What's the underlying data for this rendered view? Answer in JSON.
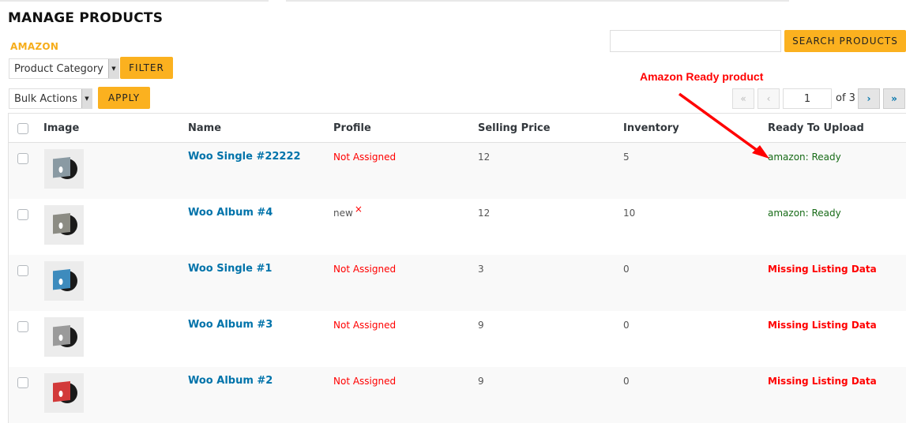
{
  "header": {
    "title": "MANAGE PRODUCTS",
    "store": "AMAZON"
  },
  "filters": {
    "category_select": "Product Category",
    "filter_label": "FILTER",
    "bulk_select": "Bulk Actions",
    "apply_label": "APPLY"
  },
  "search": {
    "value": "",
    "placeholder": "",
    "button_label": "SEARCH PRODUCTS"
  },
  "annotation": {
    "text": "Amazon Ready product",
    "color": "#ff0000"
  },
  "pagination": {
    "first": "«",
    "prev": "‹",
    "current": "1",
    "of_text": "of 3",
    "next": "›",
    "last": "»"
  },
  "table": {
    "columns": [
      "Image",
      "Name",
      "Profile",
      "Selling Price",
      "Inventory",
      "Ready To Upload"
    ],
    "rows": [
      {
        "name": "Woo Single #22222",
        "profile": "Not Assigned",
        "price": "12",
        "inventory": "5",
        "status": "amazon: Ready",
        "thumb_color": "#8a9aa3"
      },
      {
        "name": "Woo Album #4",
        "profile": "new",
        "profile_remove": "×",
        "price": "12",
        "inventory": "10",
        "status": "amazon: Ready",
        "thumb_color": "#8c8c84"
      },
      {
        "name": "Woo Single #1",
        "profile": "Not Assigned",
        "price": "3",
        "inventory": "0",
        "status": "Missing Listing Data",
        "thumb_color": "#3d8bbd"
      },
      {
        "name": "Woo Album #3",
        "profile": "Not Assigned",
        "price": "9",
        "inventory": "0",
        "status": "Missing Listing Data",
        "thumb_color": "#9a9a9a"
      },
      {
        "name": "Woo Album #2",
        "profile": "Not Assigned",
        "price": "9",
        "inventory": "0",
        "status": "Missing Listing Data",
        "thumb_color": "#d23a3a"
      }
    ]
  },
  "colors": {
    "accent": "#fbb11f",
    "link": "#0073aa",
    "error": "#ff0000",
    "ready": "#176b17"
  }
}
